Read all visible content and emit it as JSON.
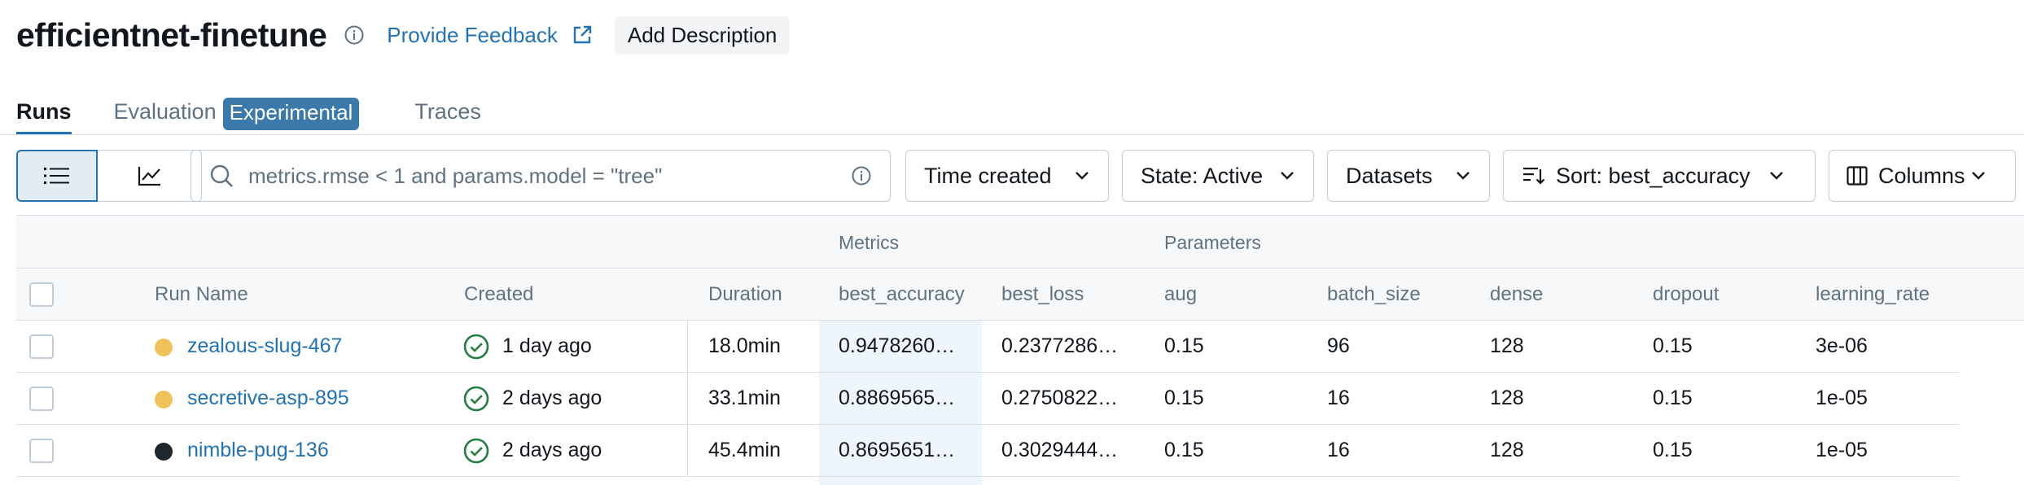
{
  "header": {
    "title": "efficientnet-finetune",
    "feedback_label": "Provide Feedback",
    "add_description_label": "Add Description"
  },
  "tabs": {
    "runs": "Runs",
    "evaluation": "Evaluation",
    "experimental_tag": "Experimental",
    "traces": "Traces"
  },
  "toolbar": {
    "search_placeholder": "metrics.rmse < 1 and params.model = \"tree\"",
    "time_created": "Time created",
    "state": "State: Active",
    "datasets": "Datasets",
    "sort": "Sort: best_accuracy",
    "columns": "Columns"
  },
  "table": {
    "groups": {
      "metrics": "Metrics",
      "parameters": "Parameters"
    },
    "columns": {
      "run_name": "Run Name",
      "created": "Created",
      "duration": "Duration",
      "best_accuracy": "best_accuracy",
      "best_loss": "best_loss",
      "aug": "aug",
      "batch_size": "batch_size",
      "dense": "dense",
      "dropout": "dropout",
      "learning_rate": "learning_rate"
    },
    "rows": [
      {
        "run_name": "zealous-slug-467",
        "dot_color": "#f0c35a",
        "created": "1 day ago",
        "duration": "18.0min",
        "best_accuracy": "0.9478260…",
        "best_loss": "0.2377286…",
        "aug": "0.15",
        "batch_size": "96",
        "dense": "128",
        "dropout": "0.15",
        "learning_rate": "3e-06"
      },
      {
        "run_name": "secretive-asp-895",
        "dot_color": "#f0c35a",
        "created": "2 days ago",
        "duration": "33.1min",
        "best_accuracy": "0.8869565…",
        "best_loss": "0.2750822…",
        "aug": "0.15",
        "batch_size": "16",
        "dense": "128",
        "dropout": "0.15",
        "learning_rate": "1e-05"
      },
      {
        "run_name": "nimble-pug-136",
        "dot_color": "#1f272d",
        "created": "2 days ago",
        "duration": "45.4min",
        "best_accuracy": "0.8695651…",
        "best_loss": "0.3029444…",
        "aug": "0.15",
        "batch_size": "16",
        "dense": "128",
        "dropout": "0.15",
        "learning_rate": "1e-05"
      }
    ]
  },
  "colors": {
    "accent": "#2272b4",
    "success": "#277c43",
    "border": "#c0cdd8",
    "muted_text": "#5f7281"
  }
}
